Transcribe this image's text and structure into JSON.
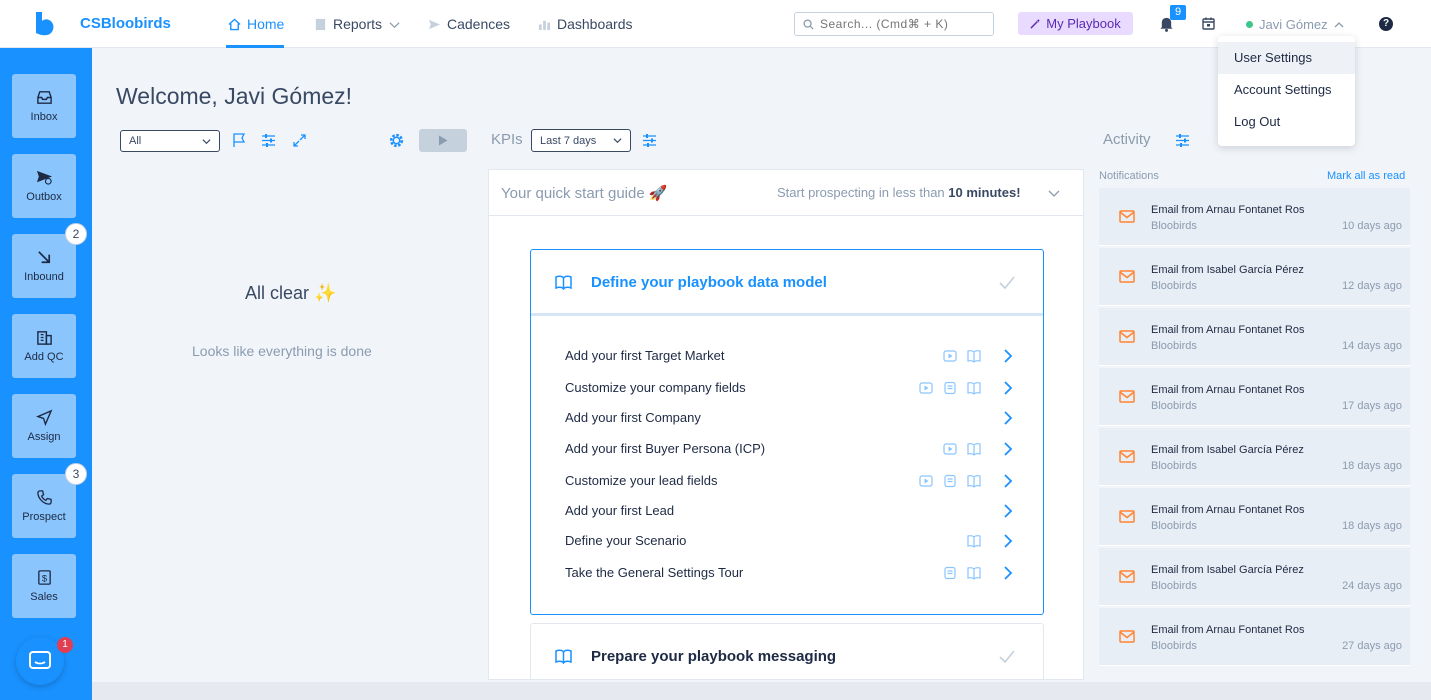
{
  "app": {
    "brand": "CSBloobirds"
  },
  "nav": [
    {
      "label": "Home",
      "icon": "home-icon",
      "active": true
    },
    {
      "label": "Reports",
      "icon": "document-icon"
    },
    {
      "label": "Cadences",
      "icon": "send-icon"
    },
    {
      "label": "Dashboards",
      "icon": "bar-chart-icon"
    }
  ],
  "search": {
    "placeholder": "Search... (Cmd⌘ + K)"
  },
  "playbook": {
    "label": "My Playbook"
  },
  "notifications_badge": "9",
  "user": {
    "name": "Javi Gómez"
  },
  "user_menu": [
    "User Settings",
    "Account Settings",
    "Log Out"
  ],
  "sidebar": [
    {
      "label": "Inbox",
      "icon": "inbox-icon"
    },
    {
      "label": "Outbox",
      "icon": "outbox-icon"
    },
    {
      "label": "Inbound",
      "icon": "inbound-arrow-icon",
      "badge": "2"
    },
    {
      "label": "Add QC",
      "icon": "building-icon"
    },
    {
      "label": "Assign",
      "icon": "paper-plane-icon"
    },
    {
      "label": "Prospect",
      "icon": "phone-icon",
      "badge": "3"
    },
    {
      "label": "Sales",
      "icon": "dollar-icon"
    }
  ],
  "chat_badge": "1",
  "main": {
    "welcome": "Welcome, Javi Gómez!",
    "filter_value": "All",
    "kpis_label": "KPIs",
    "kpi_range": "Last 7 days",
    "activity_label": "Activity",
    "clear_title": "All clear ✨",
    "clear_subtitle": "Looks like everything is done"
  },
  "quick_start": {
    "title": "Your quick start guide 🚀",
    "subtitle_prefix": "Start prospecting in less than",
    "subtitle_bold": "10 minutes!",
    "sections": [
      {
        "title": "Define your playbook data model",
        "tasks": [
          {
            "label": "Add your first Target Market",
            "icons": [
              "video-icon",
              "book-icon"
            ]
          },
          {
            "label": "Customize your company fields",
            "icons": [
              "video-icon",
              "tour-icon",
              "book-icon"
            ]
          },
          {
            "label": "Add your first Company",
            "icons": []
          },
          {
            "label": "Add your first Buyer Persona (ICP)",
            "icons": [
              "video-icon",
              "book-icon"
            ]
          },
          {
            "label": "Customize your lead fields",
            "icons": [
              "video-icon",
              "tour-icon",
              "book-icon"
            ]
          },
          {
            "label": "Add your first Lead",
            "icons": []
          },
          {
            "label": "Define your Scenario",
            "icons": [
              "book-icon"
            ]
          },
          {
            "label": "Take the General Settings Tour",
            "icons": [
              "tour-icon",
              "book-icon"
            ]
          }
        ]
      },
      {
        "title": "Prepare your playbook messaging",
        "tasks": []
      }
    ]
  },
  "notifications": {
    "title": "Notifications",
    "mark_all": "Mark all as read",
    "items": [
      {
        "title": "Email from Arnau Fontanet Ros",
        "source": "Bloobirds",
        "time": "10 days ago"
      },
      {
        "title": "Email from Isabel García Pérez",
        "source": "Bloobirds",
        "time": "12 days ago"
      },
      {
        "title": "Email from Arnau Fontanet Ros",
        "source": "Bloobirds",
        "time": "14 days ago"
      },
      {
        "title": "Email from Arnau Fontanet Ros",
        "source": "Bloobirds",
        "time": "17 days ago"
      },
      {
        "title": "Email from Isabel García Pérez",
        "source": "Bloobirds",
        "time": "18 days ago"
      },
      {
        "title": "Email from Arnau Fontanet Ros",
        "source": "Bloobirds",
        "time": "18 days ago"
      },
      {
        "title": "Email from Isabel García Pérez",
        "source": "Bloobirds",
        "time": "24 days ago"
      },
      {
        "title": "Email from Arnau Fontanet Ros",
        "source": "Bloobirds",
        "time": "27 days ago"
      }
    ]
  },
  "colors": {
    "accent": "#1991ff",
    "sidebar_button": "#8ac5fd",
    "notification_icon": "#ff8433"
  }
}
